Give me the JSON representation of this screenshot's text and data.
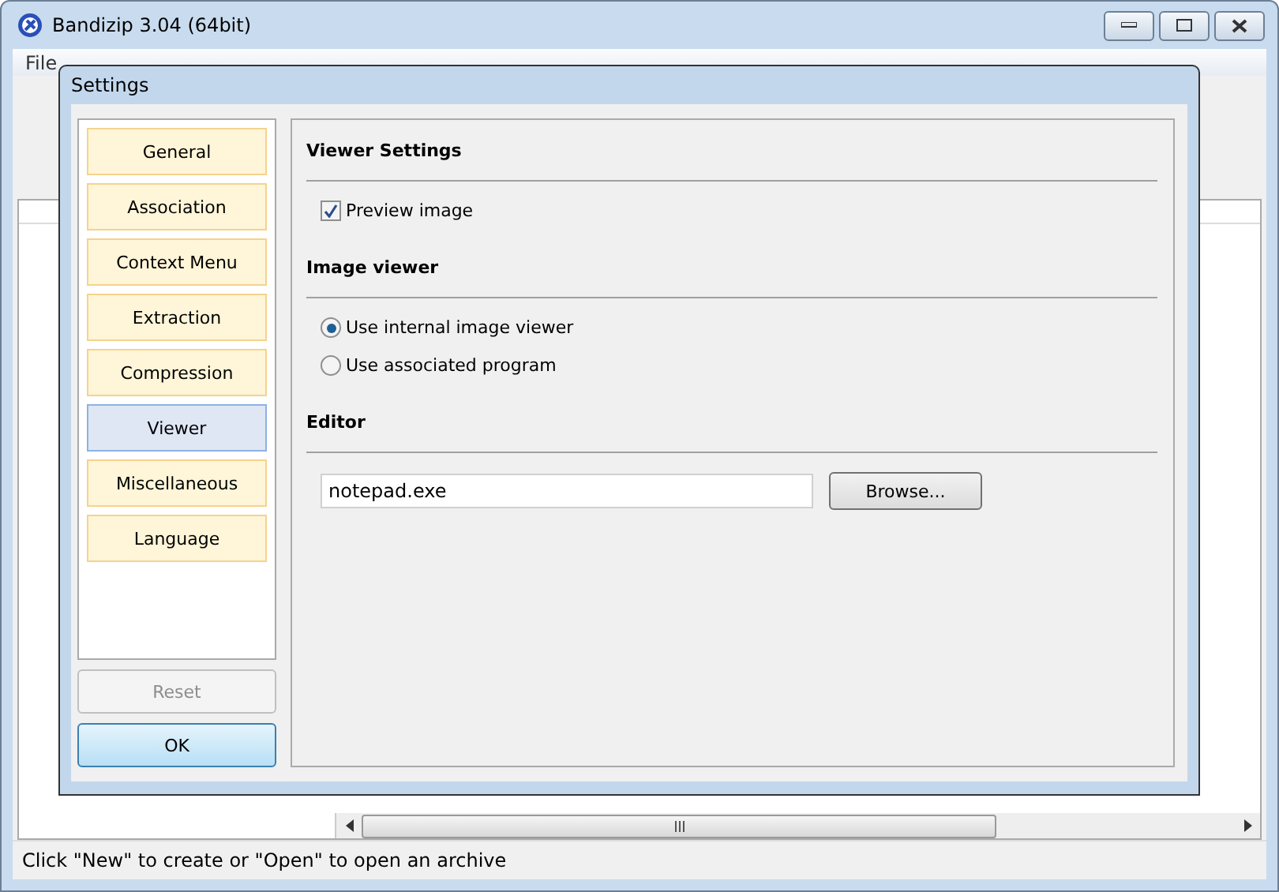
{
  "window": {
    "title": "Bandizip 3.04 (64bit)"
  },
  "menu": [
    "File"
  ],
  "status_bar": {
    "text": "Click \"New\" to create or \"Open\" to open an archive"
  },
  "dialog": {
    "title": "Settings",
    "nav": [
      {
        "label": "General",
        "selected": false
      },
      {
        "label": "Association",
        "selected": false
      },
      {
        "label": "Context Menu",
        "selected": false
      },
      {
        "label": "Extraction",
        "selected": false
      },
      {
        "label": "Compression",
        "selected": false
      },
      {
        "label": "Viewer",
        "selected": true
      },
      {
        "label": "Miscellaneous",
        "selected": false
      },
      {
        "label": "Language",
        "selected": false
      }
    ],
    "reset_button": {
      "label": "Reset",
      "disabled": true
    },
    "ok_button": {
      "label": "OK"
    },
    "sections": [
      {
        "heading": "Viewer Settings",
        "items": [
          {
            "kind": "checkbox",
            "label": "Preview image",
            "checked": true
          }
        ]
      },
      {
        "heading": "Image viewer",
        "items": [
          {
            "kind": "radio",
            "label": "Use internal image viewer",
            "selected": true
          },
          {
            "kind": "radio",
            "label": "Use associated program",
            "selected": false
          }
        ]
      },
      {
        "heading": "Editor",
        "items": [
          {
            "kind": "path",
            "value": "notepad.exe",
            "button": "Browse..."
          }
        ]
      }
    ]
  }
}
